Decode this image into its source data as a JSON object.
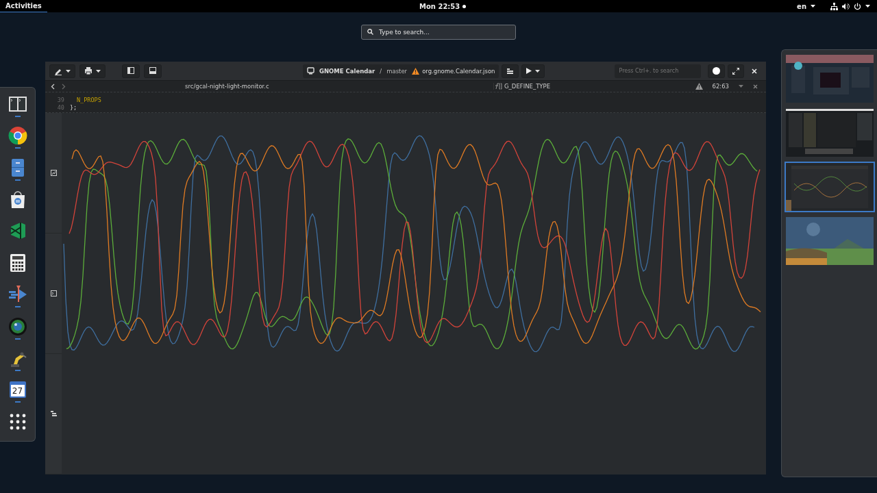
{
  "top_bar": {
    "activities": "Activities",
    "clock": "Mon 22:53",
    "notification": true,
    "keyboard": "en"
  },
  "search": {
    "placeholder": "Type to search..."
  },
  "dock": [
    {
      "kind": "terminal",
      "running": true
    },
    {
      "kind": "browser",
      "running": true
    },
    {
      "kind": "files",
      "running": true
    },
    {
      "kind": "software",
      "running": false
    },
    {
      "kind": "code-editor",
      "running": false
    },
    {
      "kind": "calculator",
      "running": false
    },
    {
      "kind": "builder",
      "running": true
    },
    {
      "kind": "camera",
      "running": true
    },
    {
      "kind": "robot",
      "running": true
    },
    {
      "kind": "calendar",
      "label": "27",
      "running": true
    },
    {
      "kind": "app-grid",
      "running": false
    }
  ],
  "window": {
    "header": {
      "left_buttons": [
        {
          "kind": "pencil",
          "menu": true
        },
        {
          "kind": "printer",
          "menu": true
        },
        {
          "kind": "sidebar"
        },
        {
          "kind": "bottom-panel"
        }
      ],
      "project": "GNOME Calendar",
      "separator": "/",
      "branch": "master",
      "config": "org.gnome.Calendar.json",
      "config_warning": true,
      "search_placeholder": "Press Ctrl+. to search",
      "right_buttons": [
        {
          "kind": "record"
        },
        {
          "kind": "fullscreen"
        },
        {
          "kind": "close"
        }
      ]
    },
    "path_bar": {
      "file": "src/gcal-night-light-monitor.c",
      "symbol": "G_DEFINE_TYPE",
      "warning": true,
      "position": "62:63"
    },
    "code_lines": [
      {
        "number": "39",
        "code": "N_PROPS",
        "kind": "constant"
      },
      {
        "number": "40",
        "code": "};",
        "kind": "plain"
      }
    ],
    "gutter": [
      {
        "kind": "graph"
      },
      {
        "kind": "terminal"
      },
      {
        "kind": "tree"
      }
    ]
  },
  "workspaces": [
    {
      "kind": "picture",
      "selected": false
    },
    {
      "kind": "picture",
      "selected": false
    },
    {
      "kind": "picture",
      "selected": true
    },
    {
      "kind": "picture",
      "selected": false
    }
  ]
}
